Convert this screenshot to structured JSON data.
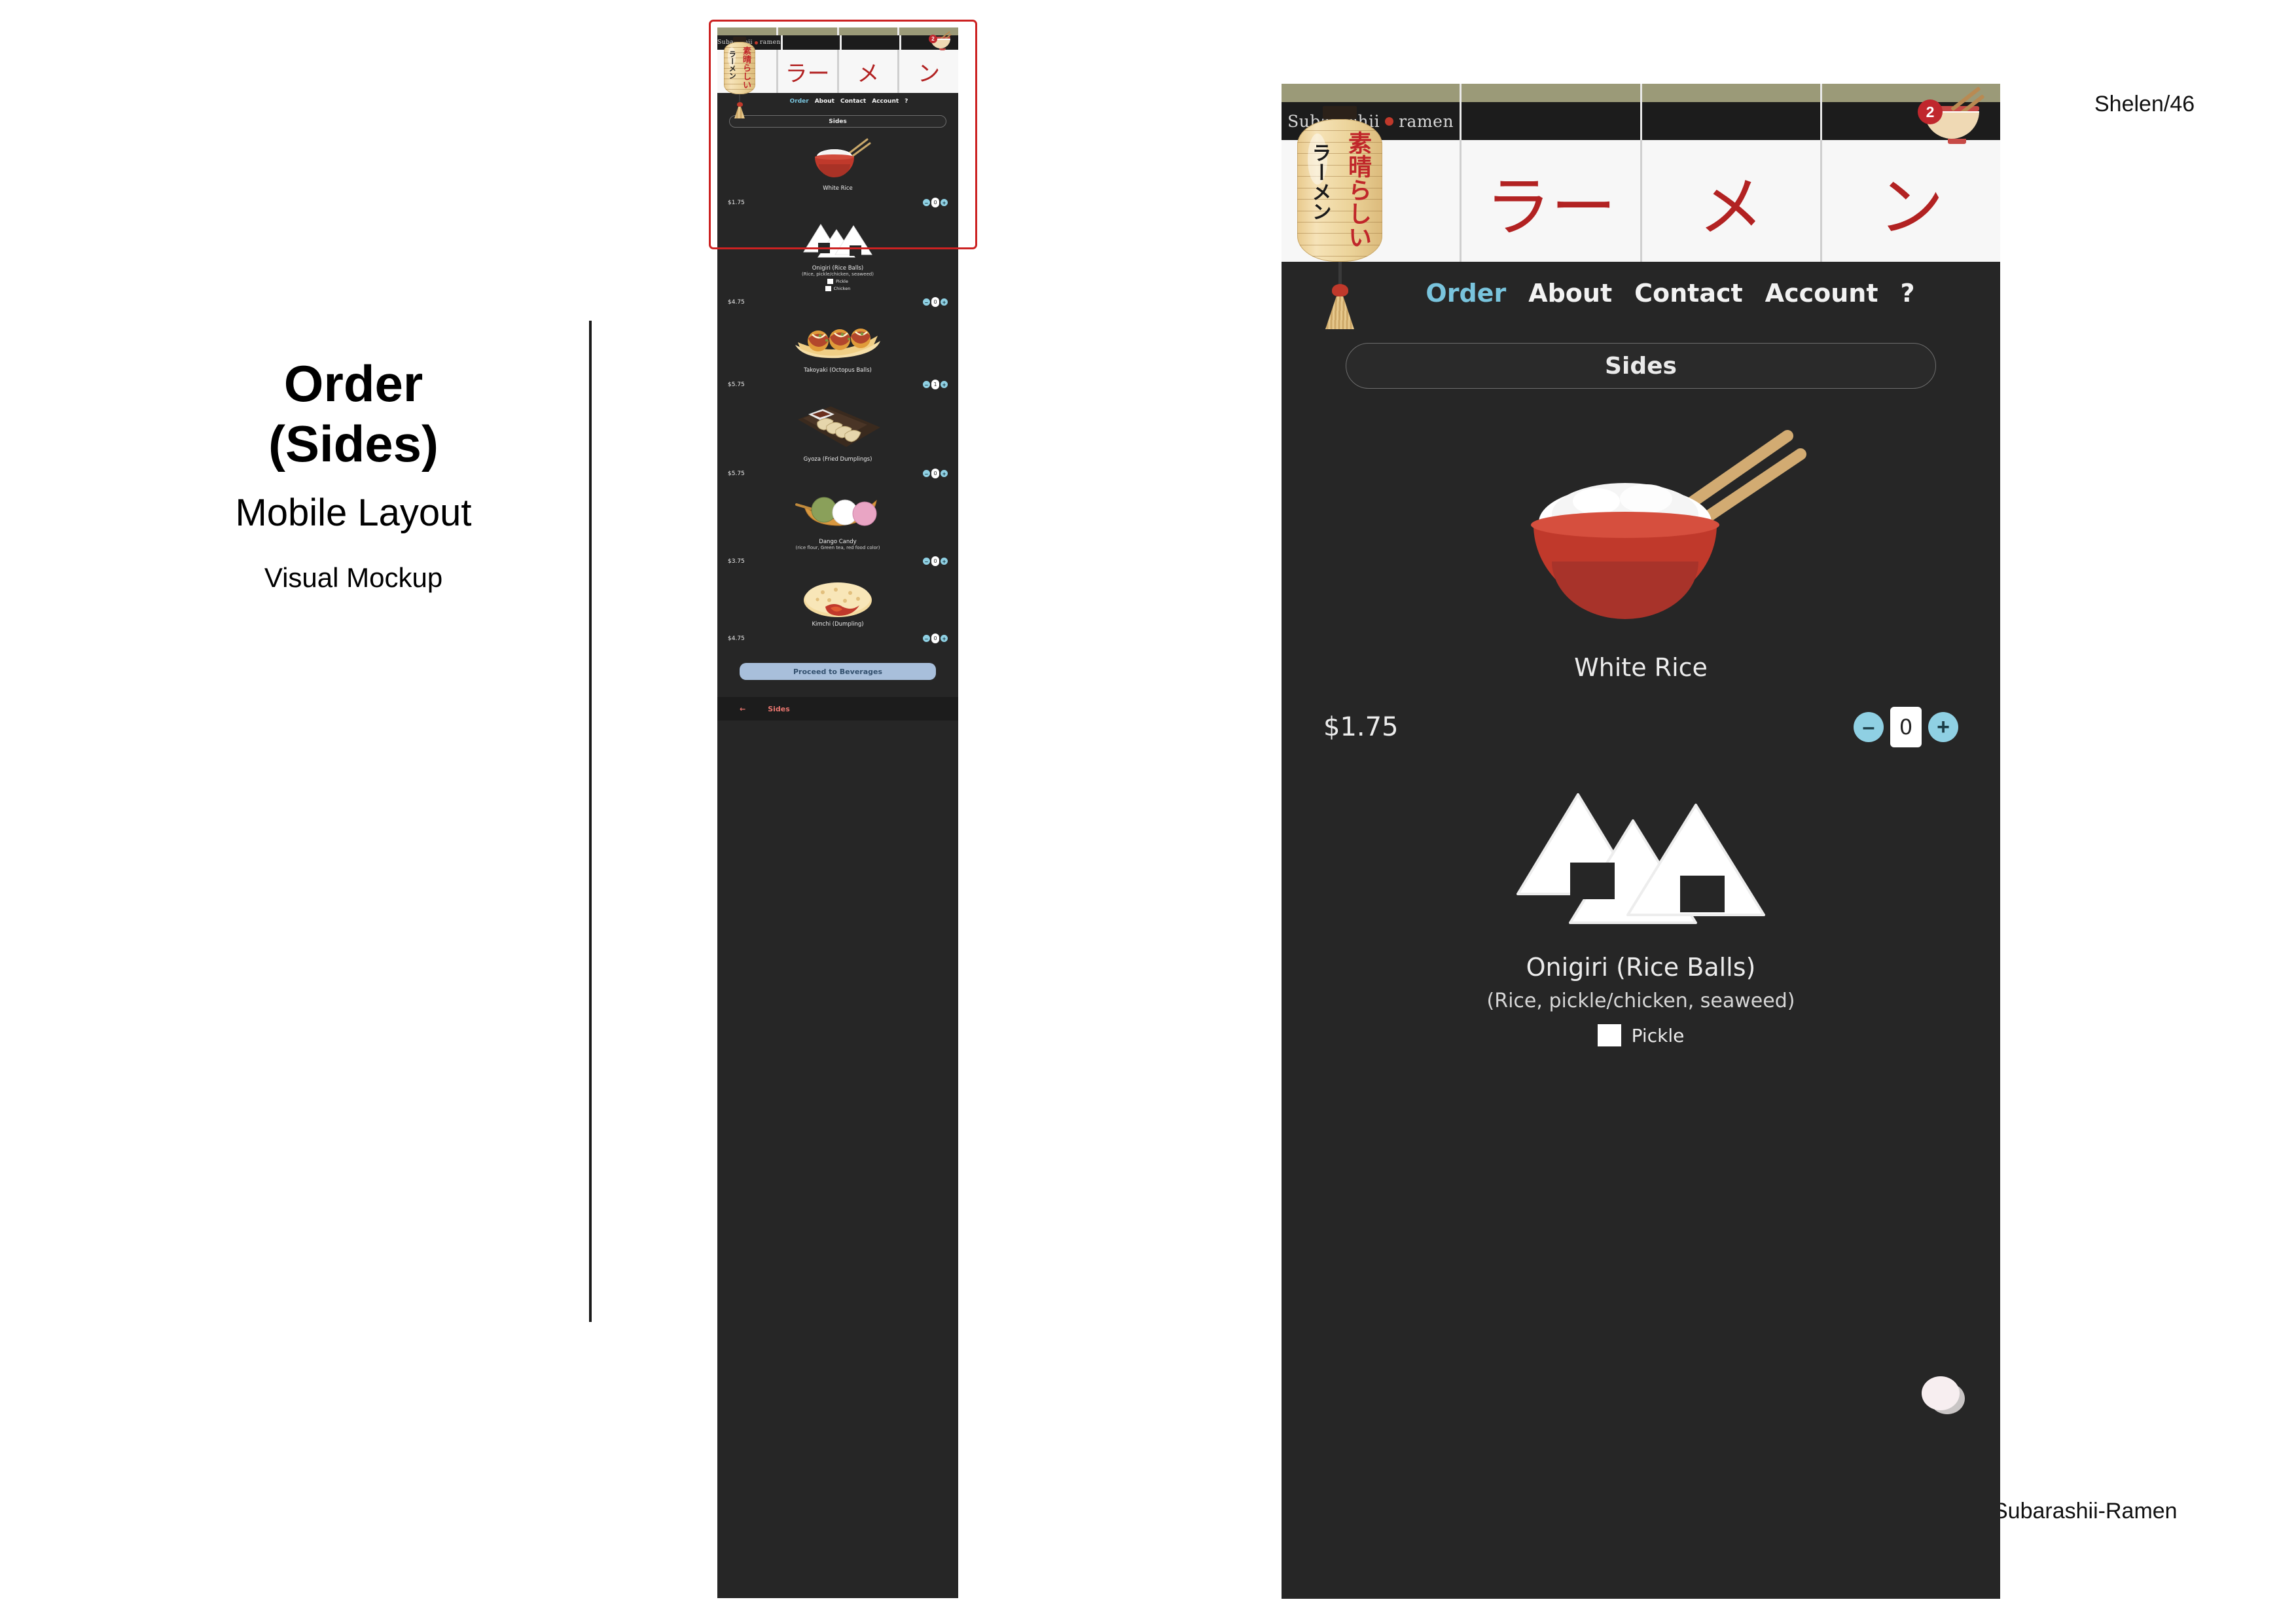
{
  "slide": {
    "title_line1": "Order",
    "title_line2": "(Sides)",
    "subtitle": "Mobile Layout",
    "caption": "Visual Mockup",
    "corner_top_right": "Shelen/46",
    "corner_bottom_right": "Subarashii-Ramen"
  },
  "brand": {
    "logo_text_left": "Subarashii",
    "logo_text_right": "ramen",
    "lantern_red_text": "素晴らしい",
    "lantern_black_text": "ラーメン",
    "kanji": [
      "ラー",
      "メ",
      "ン"
    ],
    "accent_red": "#c0262a",
    "accent_blue": "#79c4dd",
    "dark_bg": "#262626",
    "strip_olive": "#9b9a78"
  },
  "cart": {
    "badge_count": "2",
    "icon": "ramen-bowl-icon"
  },
  "nav": {
    "items": [
      {
        "label": "Order",
        "active": true
      },
      {
        "label": "About",
        "active": false
      },
      {
        "label": "Contact",
        "active": false
      },
      {
        "label": "Account",
        "active": false
      },
      {
        "label": "?",
        "active": false
      }
    ]
  },
  "category_pill": "Sides",
  "menu": {
    "items": [
      {
        "name": "White Rice",
        "sub": "",
        "price": "$1.75",
        "qty": "0",
        "image": "rice-bowl-chopsticks",
        "options": []
      },
      {
        "name": "Onigiri (Rice Balls)",
        "sub": "(Rice, pickle/chicken, seaweed)",
        "price": "$4.75",
        "qty": "0",
        "image": "onigiri-triangles",
        "options": [
          {
            "label": "Pickle",
            "checked": false
          },
          {
            "label": "Chicken",
            "checked": false
          }
        ]
      },
      {
        "name": "Takoyaki (Octopus Balls)",
        "sub": "",
        "price": "$5.75",
        "qty": "1",
        "image": "takoyaki-tray",
        "options": []
      },
      {
        "name": "Gyoza (Fried Dumplings)",
        "sub": "",
        "price": "$5.75",
        "qty": "0",
        "image": "gyoza-board",
        "options": []
      },
      {
        "name": "Dango Candy",
        "sub": "(rice flour, Green tea, red food color)",
        "price": "$3.75",
        "qty": "0",
        "image": "dango-skewer",
        "options": []
      },
      {
        "name": "Kimchi (Dumpling)",
        "sub": "",
        "price": "$4.75",
        "qty": "0",
        "image": "kimchi-pancake",
        "options": []
      }
    ]
  },
  "stepper": {
    "minus": "–",
    "plus": "+"
  },
  "proceed_button": "Proceed to Beverages",
  "footer": {
    "back_icon": "back-arrow-icon",
    "label": "Sides"
  }
}
